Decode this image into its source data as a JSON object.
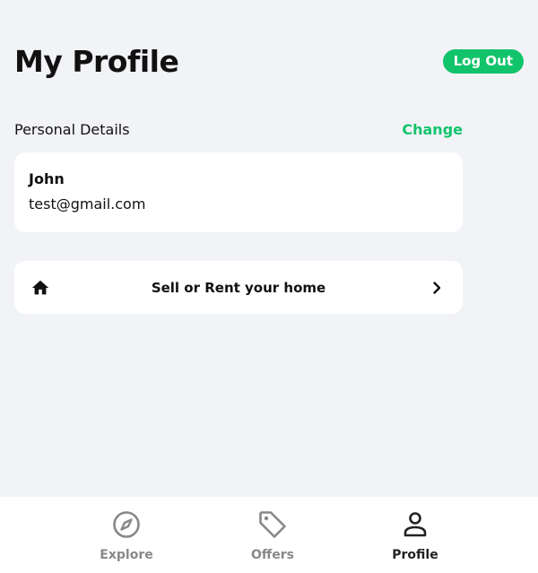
{
  "header": {
    "title": "My Profile",
    "logout_label": "Log Out"
  },
  "personal_details": {
    "section_title": "Personal Details",
    "change_label": "Change",
    "name": "John",
    "email": "test@gmail.com"
  },
  "sell_card": {
    "label": "Sell or Rent your home",
    "icon": "home-icon",
    "chevron": "chevron-right-icon"
  },
  "bottom_nav": {
    "items": [
      {
        "label": "Explore",
        "icon": "compass-icon",
        "active": false
      },
      {
        "label": "Offers",
        "icon": "tag-icon",
        "active": false
      },
      {
        "label": "Profile",
        "icon": "person-icon",
        "active": true
      }
    ]
  },
  "colors": {
    "accent": "#11c46b",
    "background": "#f2f3f7",
    "card": "#ffffff",
    "nav_inactive": "#888888",
    "nav_active": "#222222"
  }
}
